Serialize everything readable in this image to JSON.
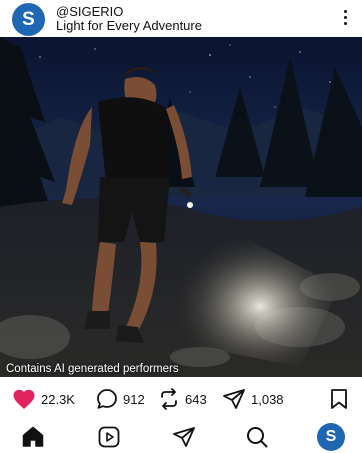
{
  "post": {
    "avatar_letter": "S",
    "handle": "@SIGERIO",
    "tagline": "Light for Every Adventure",
    "more_icon": "more-vertical-icon",
    "ai_label": "Contains AI generated performers"
  },
  "actions": {
    "likes": "22.3K",
    "comments": "912",
    "reposts": "643",
    "shares": "1,038",
    "icons": [
      "heart-icon",
      "comment-icon",
      "repost-icon",
      "share-icon",
      "bookmark-icon"
    ],
    "liked_color": "#e0245e"
  },
  "nav": {
    "icons": [
      "home-icon",
      "reels-icon",
      "send-icon",
      "search-icon",
      "profile-avatar"
    ],
    "avatar_letter": "S"
  },
  "colors": {
    "brand": "#1f66b3"
  }
}
